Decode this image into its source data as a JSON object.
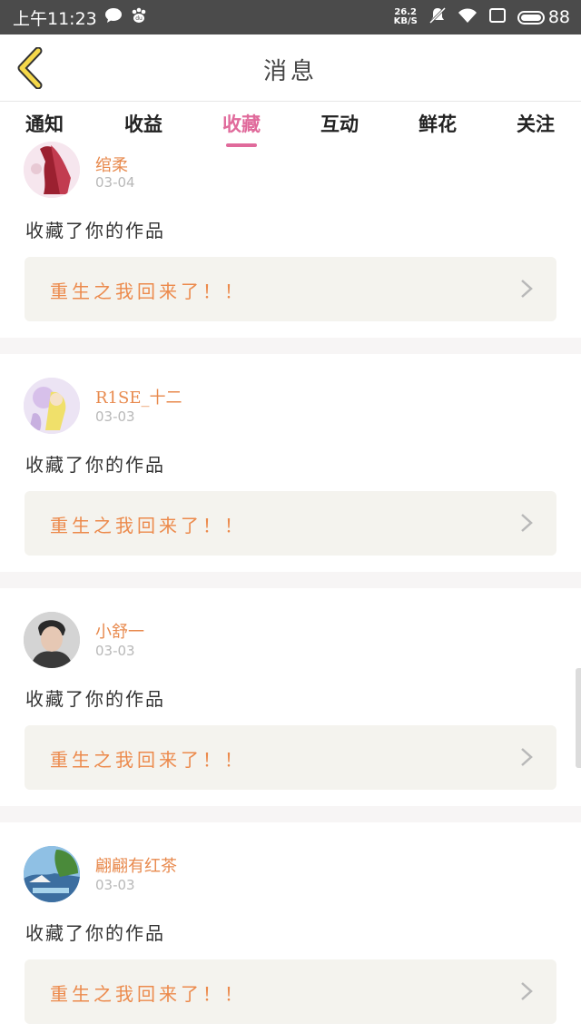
{
  "status_bar": {
    "time": "上午11:23",
    "net_speed_value": "26.2",
    "net_speed_unit": "KB/S",
    "battery": "88"
  },
  "header": {
    "title": "消息"
  },
  "tabs": [
    {
      "label": "通知",
      "active": false
    },
    {
      "label": "收益",
      "active": false
    },
    {
      "label": "收藏",
      "active": true
    },
    {
      "label": "互动",
      "active": false
    },
    {
      "label": "鲜花",
      "active": false
    },
    {
      "label": "关注",
      "active": false
    }
  ],
  "messages": [
    {
      "username": "绾柔",
      "date": "03-04",
      "action": "收藏了你的作品",
      "work_title": "重生之我回来了！！"
    },
    {
      "username": "R1SE_十二",
      "date": "03-03",
      "action": "收藏了你的作品",
      "work_title": "重生之我回来了！！"
    },
    {
      "username": "小舒一",
      "date": "03-03",
      "action": "收藏了你的作品",
      "work_title": "重生之我回来了！！"
    },
    {
      "username": "翩翩有红茶",
      "date": "03-03",
      "action": "收藏了你的作品",
      "work_title": "重生之我回来了！！"
    }
  ],
  "colors": {
    "accent": "#e06a9b",
    "username": "#e88a4e",
    "work_title": "#ec8a4c",
    "work_box_bg": "#f4f3ee"
  }
}
